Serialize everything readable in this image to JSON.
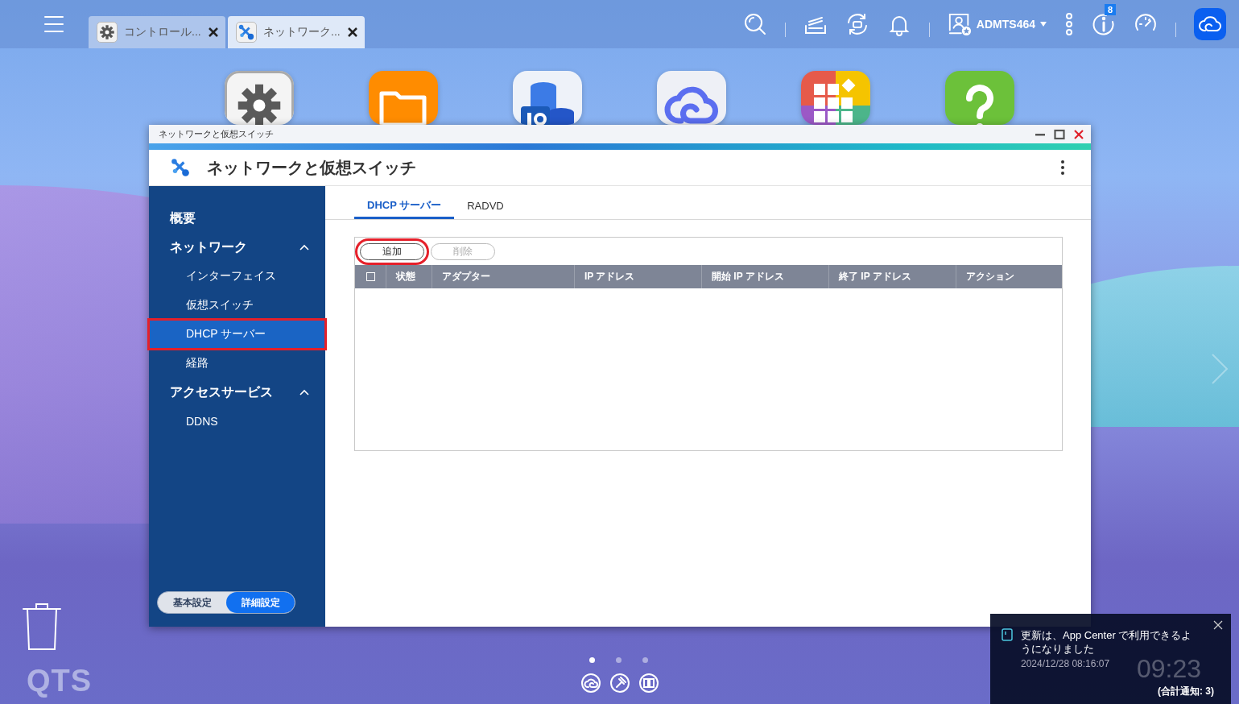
{
  "topbar": {
    "tabs": [
      {
        "label": "コントロール...",
        "selected": false,
        "kind": "settings"
      },
      {
        "label": "ネットワーク...",
        "selected": true,
        "kind": "network"
      }
    ],
    "user": "ADMTS464",
    "info_badge": "8"
  },
  "window": {
    "caption": "ネットワークと仮想スイッチ",
    "title": "ネットワークと仮想スイッチ",
    "sidebar": {
      "items": [
        {
          "label": "概要",
          "kind": "link",
          "selected": false
        },
        {
          "label": "ネットワーク",
          "kind": "group",
          "expanded": true,
          "children": [
            {
              "label": "インターフェイス",
              "selected": false,
              "highlighted": false
            },
            {
              "label": "仮想スイッチ",
              "selected": false,
              "highlighted": false
            },
            {
              "label": "DHCP サーバー",
              "selected": true,
              "highlighted": true
            },
            {
              "label": "経路",
              "selected": false,
              "highlighted": false
            }
          ]
        },
        {
          "label": "アクセスサービス",
          "kind": "group",
          "expanded": true,
          "children": [
            {
              "label": "DDNS",
              "selected": false,
              "highlighted": false
            }
          ]
        }
      ],
      "mode_toggle": [
        {
          "label": "基本設定",
          "selected": false
        },
        {
          "label": "詳細設定",
          "selected": true
        }
      ]
    },
    "tabs": [
      {
        "label": "DHCP サーバー",
        "selected": true
      },
      {
        "label": "RADVD",
        "selected": false
      }
    ],
    "toolbar": [
      {
        "label": "追加",
        "disabled": false,
        "highlighted": true
      },
      {
        "label": "削除",
        "disabled": true,
        "highlighted": false
      }
    ],
    "table": {
      "select_all_checked": false,
      "columns": [
        "状態",
        "アダプター",
        "IP アドレス",
        "開始 IP アドレス",
        "終了 IP アドレス",
        "アクション"
      ]
    }
  },
  "notification": {
    "message": "更新は、App Center で利用できるようになりました",
    "time": "2024/12/28 08:16:07",
    "total": "(合計通知: 3)"
  },
  "clock": "09:23",
  "logo": "QTS",
  "pages": [
    {
      "selected": true
    },
    {
      "selected": false
    },
    {
      "selected": false
    }
  ]
}
